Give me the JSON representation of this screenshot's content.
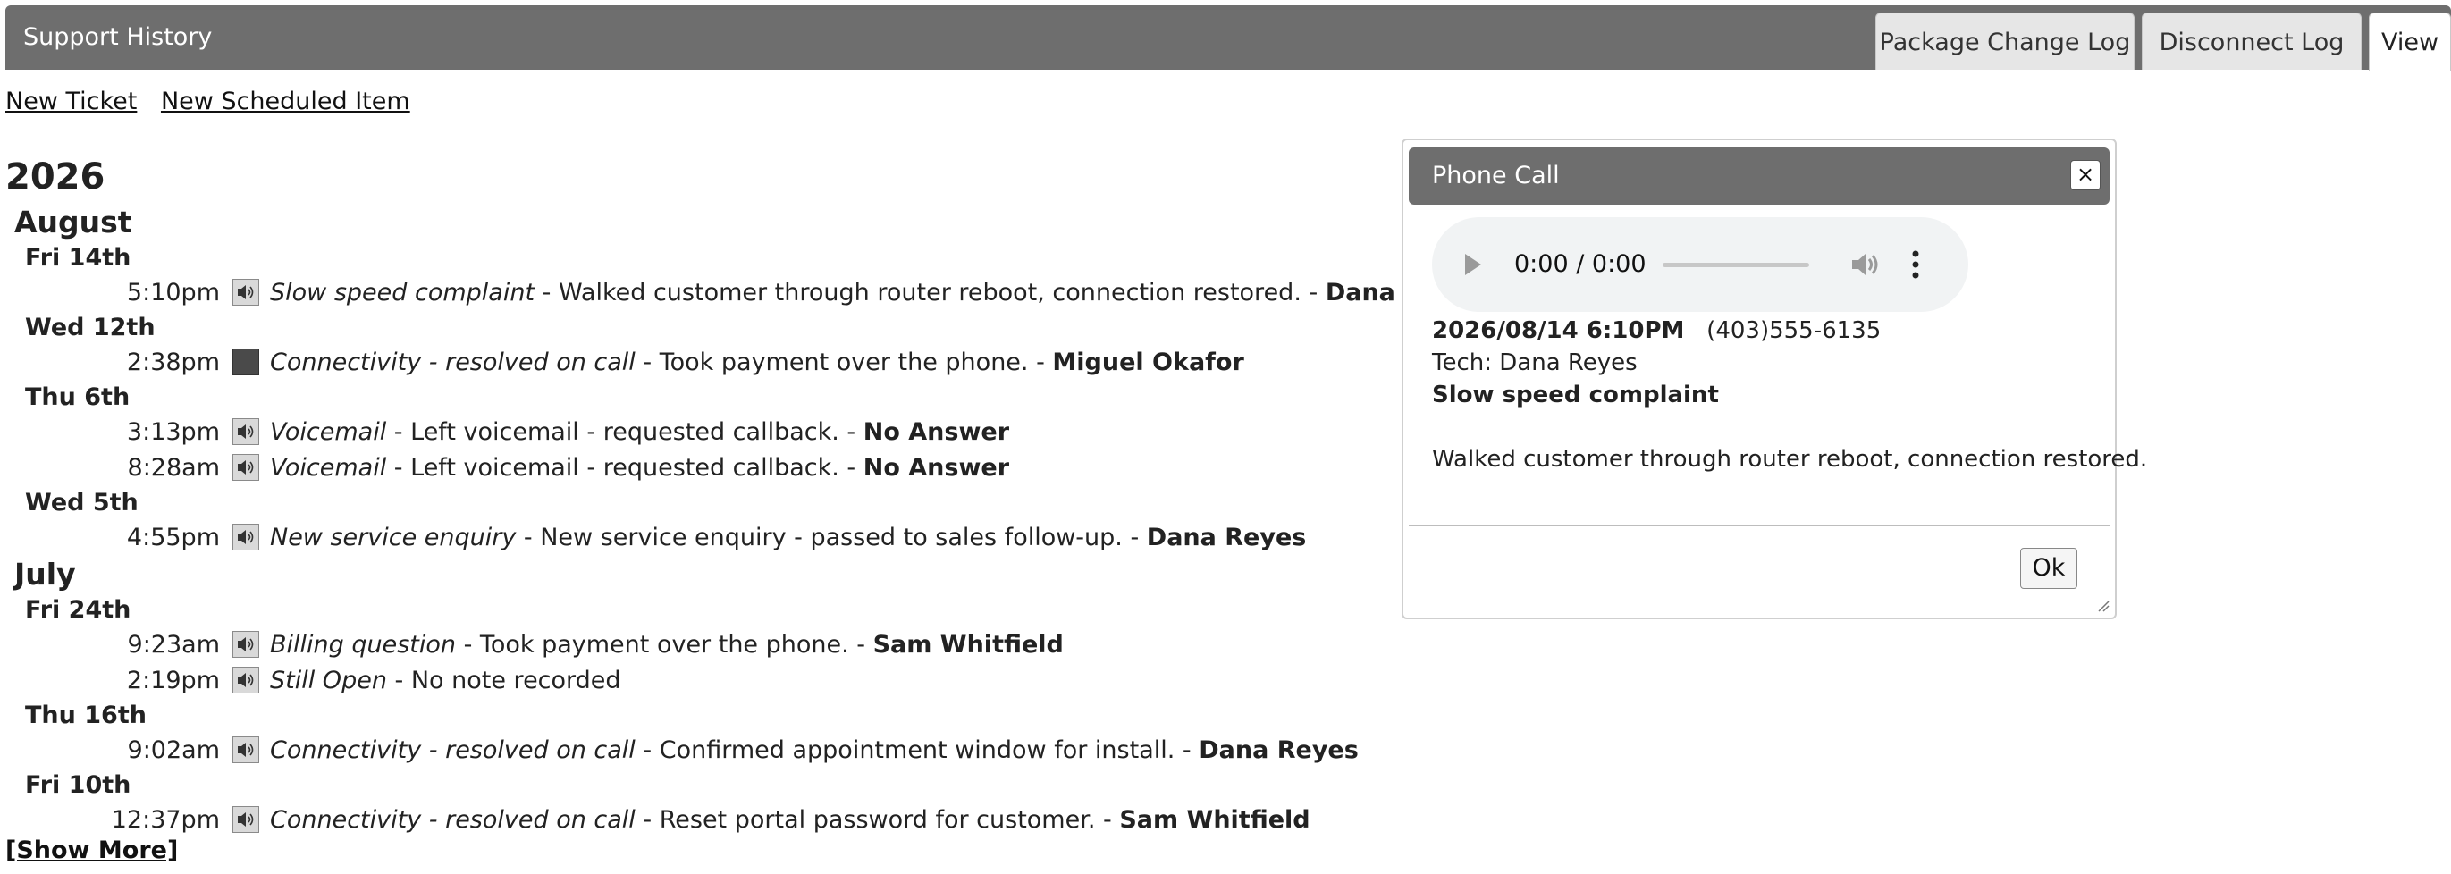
{
  "header": {
    "title": "Support History",
    "tabs": [
      "Package Change Log",
      "Disconnect Log",
      "View"
    ]
  },
  "actions": [
    "New Ticket",
    "New Scheduled Item"
  ],
  "history": {
    "year": "2026",
    "months": [
      {
        "name": "August",
        "days": [
          {
            "label": "Fri 14th",
            "entries": [
              {
                "time": "5:10pm",
                "category": "Slow speed complaint",
                "note": " - Walked customer through router reboot, connection restored. - ",
                "tech": "Dana Reyes",
                "icon": "speaker-icon"
              }
            ]
          },
          {
            "label": "Wed 12th",
            "entries": [
              {
                "time": "2:38pm",
                "category": "Connectivity - resolved on call",
                "note": " - Took payment over the phone. - ",
                "tech": "Miguel Okafor",
                "icon": "speaker-icon-selected"
              }
            ]
          },
          {
            "label": "Thu 6th",
            "entries": [
              {
                "time": "3:13pm",
                "category": "Voicemail",
                "note": " - Left voicemail - requested callback. - ",
                "tech": "No Answer",
                "icon": "speaker-icon"
              },
              {
                "time": "8:28am",
                "category": "Voicemail",
                "note": " - Left voicemail - requested callback. - ",
                "tech": "No Answer",
                "icon": "speaker-icon"
              }
            ]
          },
          {
            "label": "Wed 5th",
            "entries": [
              {
                "time": "4:55pm",
                "category": "New service enquiry",
                "note": " - New service enquiry - passed to sales follow-up. - ",
                "tech": "Dana Reyes",
                "icon": "speaker-icon"
              }
            ]
          }
        ]
      },
      {
        "name": "July",
        "days": [
          {
            "label": "Fri 24th",
            "entries": [
              {
                "time": "9:23am",
                "category": "Billing question",
                "note": " - Took payment over the phone. - ",
                "tech": "Sam Whitfield",
                "icon": "speaker-icon"
              },
              {
                "time": "2:19pm",
                "category": "Still Open",
                "note": " - No note recorded",
                "tech": "",
                "icon": "speaker-icon"
              }
            ]
          },
          {
            "label": "Thu 16th",
            "entries": [
              {
                "time": "9:02am",
                "category": "Connectivity - resolved on call",
                "note": " - Confirmed appointment window for install. - ",
                "tech": "Dana Reyes",
                "icon": "speaker-icon"
              }
            ]
          },
          {
            "label": "Fri 10th",
            "entries": [
              {
                "time": "12:37pm",
                "category": "Connectivity - resolved on call",
                "note": " - Reset portal password for customer. - ",
                "tech": "Sam Whitfield",
                "icon": "speaker-icon"
              }
            ]
          }
        ]
      }
    ],
    "show_more": "[Show More]"
  },
  "dialog": {
    "title": "Phone Call",
    "close": "×",
    "audio": {
      "time": "0:00 / 0:00",
      "progress": 0
    },
    "datetime": "2026/08/14 6:10PM",
    "phone": "(403)555-6135",
    "tech": "Tech: Dana Reyes",
    "category": "Slow speed complaint",
    "note": "Walked customer through router reboot, connection restored.",
    "ok": "Ok"
  },
  "colors": {
    "header_bg": "#6e6e6e",
    "tab_bg": "#e6e6e6",
    "audio_bg": "#f1f3f4"
  }
}
